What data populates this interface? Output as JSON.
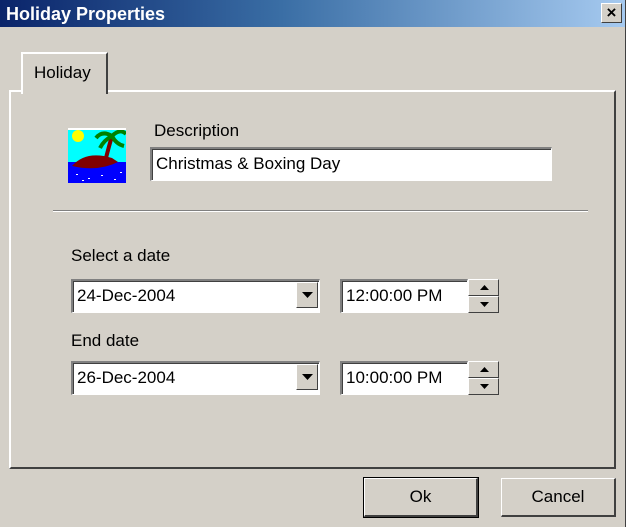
{
  "window": {
    "title": "Holiday Properties",
    "close_glyph": "×"
  },
  "tabs": [
    {
      "label": "Holiday",
      "selected": true
    }
  ],
  "description": {
    "label": "Description",
    "value": "Christmas & Boxing Day",
    "icon": "holiday-island-icon"
  },
  "start": {
    "label": "Select a date",
    "date": "24-Dec-2004",
    "time": "12:00:00 PM"
  },
  "end": {
    "label": "End date",
    "date": "26-Dec-2004",
    "time": "10:00:00 PM"
  },
  "buttons": {
    "ok": "Ok",
    "cancel": "Cancel"
  },
  "colors": {
    "titlebar_start": "#0a246a",
    "titlebar_end": "#a6caf0",
    "face": "#d4d0c8"
  }
}
